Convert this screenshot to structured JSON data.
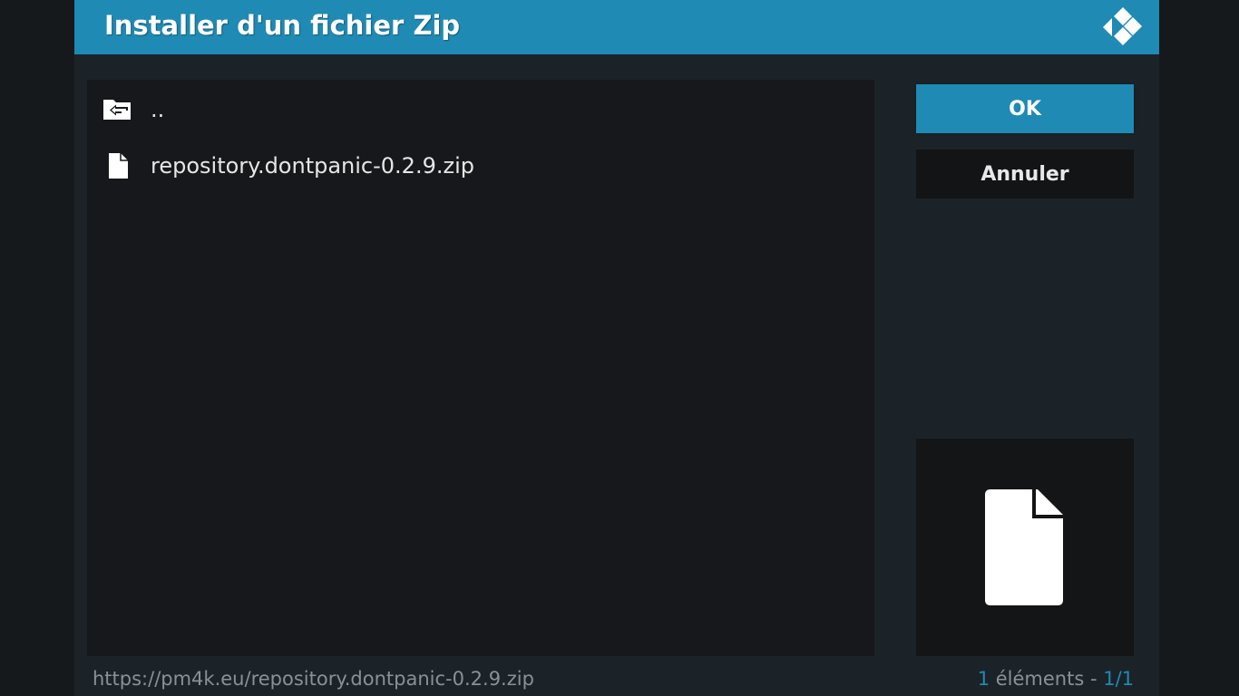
{
  "dialog": {
    "title": "Installer d'un fichier Zip",
    "logo_icon": "kodi-logo-icon"
  },
  "filelist": {
    "items": [
      {
        "label": "..",
        "icon": "folder-back-icon"
      },
      {
        "label": "repository.dontpanic-0.2.9.zip",
        "icon": "file-icon"
      }
    ]
  },
  "buttons": {
    "ok_label": "OK",
    "cancel_label": "Annuler"
  },
  "preview": {
    "icon": "file-icon"
  },
  "status": {
    "path": "https://pm4k.eu/repository.dontpanic-0.2.9.zip",
    "count": "1",
    "count_suffix": " éléments - ",
    "page": "1/1"
  },
  "colors": {
    "accent": "#1f8ab3",
    "dialog_bg": "#1b2328",
    "list_bg": "#16181b",
    "text": "#e6e6e6",
    "muted": "#8a9196"
  }
}
